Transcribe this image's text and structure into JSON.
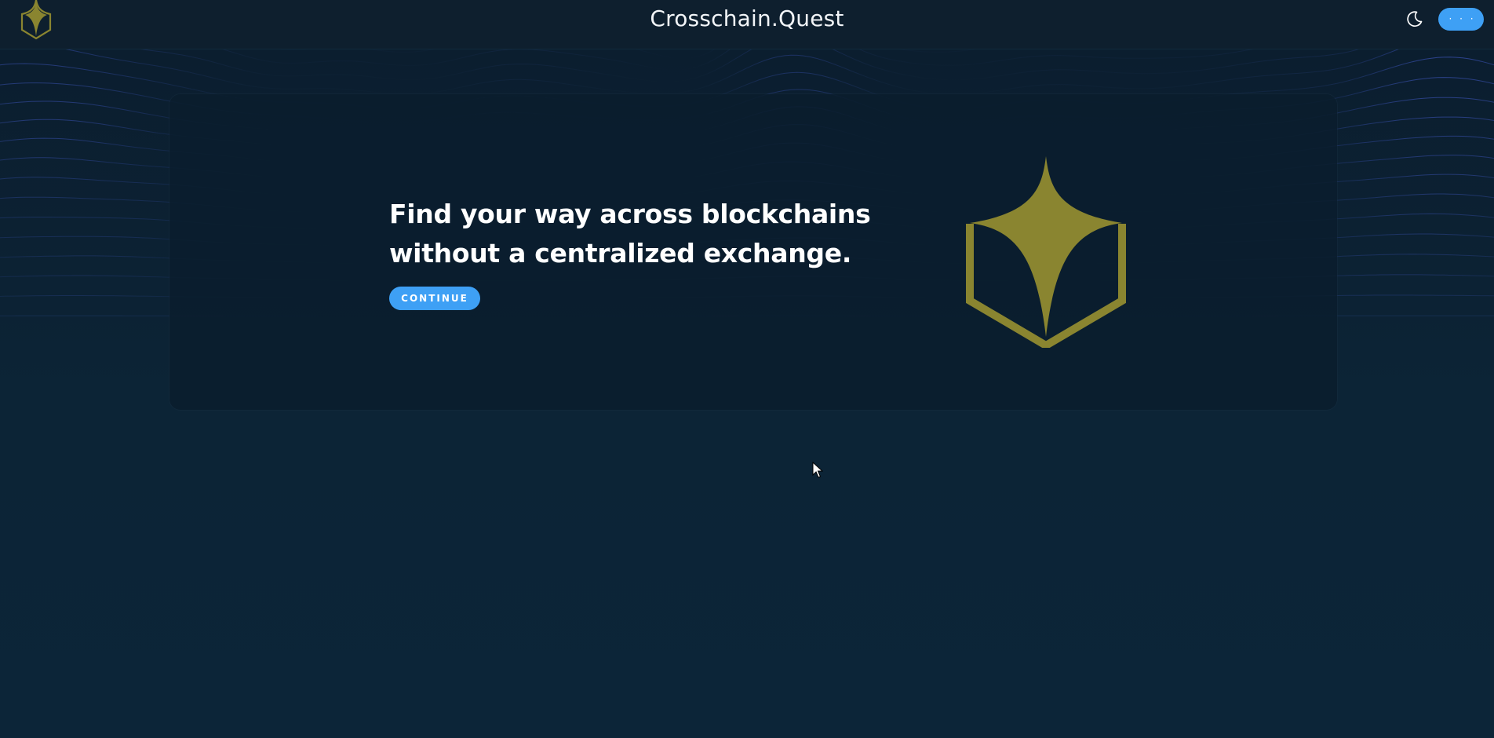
{
  "header": {
    "site_title": "Crosschain.Quest",
    "logo_icon": "crosschain-quest-logo-icon",
    "theme_toggle_icon": "moon-icon",
    "menu_button_label": "· · ·"
  },
  "hero": {
    "heading": "Find your way across blockchains without a centralized exchange.",
    "continue_label": "CONTINUE",
    "emblem_icon": "crosschain-quest-star-emblem-icon"
  },
  "colors": {
    "background": "#0c2334",
    "header_background": "#0e1f2e",
    "card_background": "#0b1d2d",
    "accent_blue": "#3ea0f5",
    "emblem_gold": "#8a8530",
    "wave_lines": "#3a5bd0",
    "text": "#ffffff"
  }
}
